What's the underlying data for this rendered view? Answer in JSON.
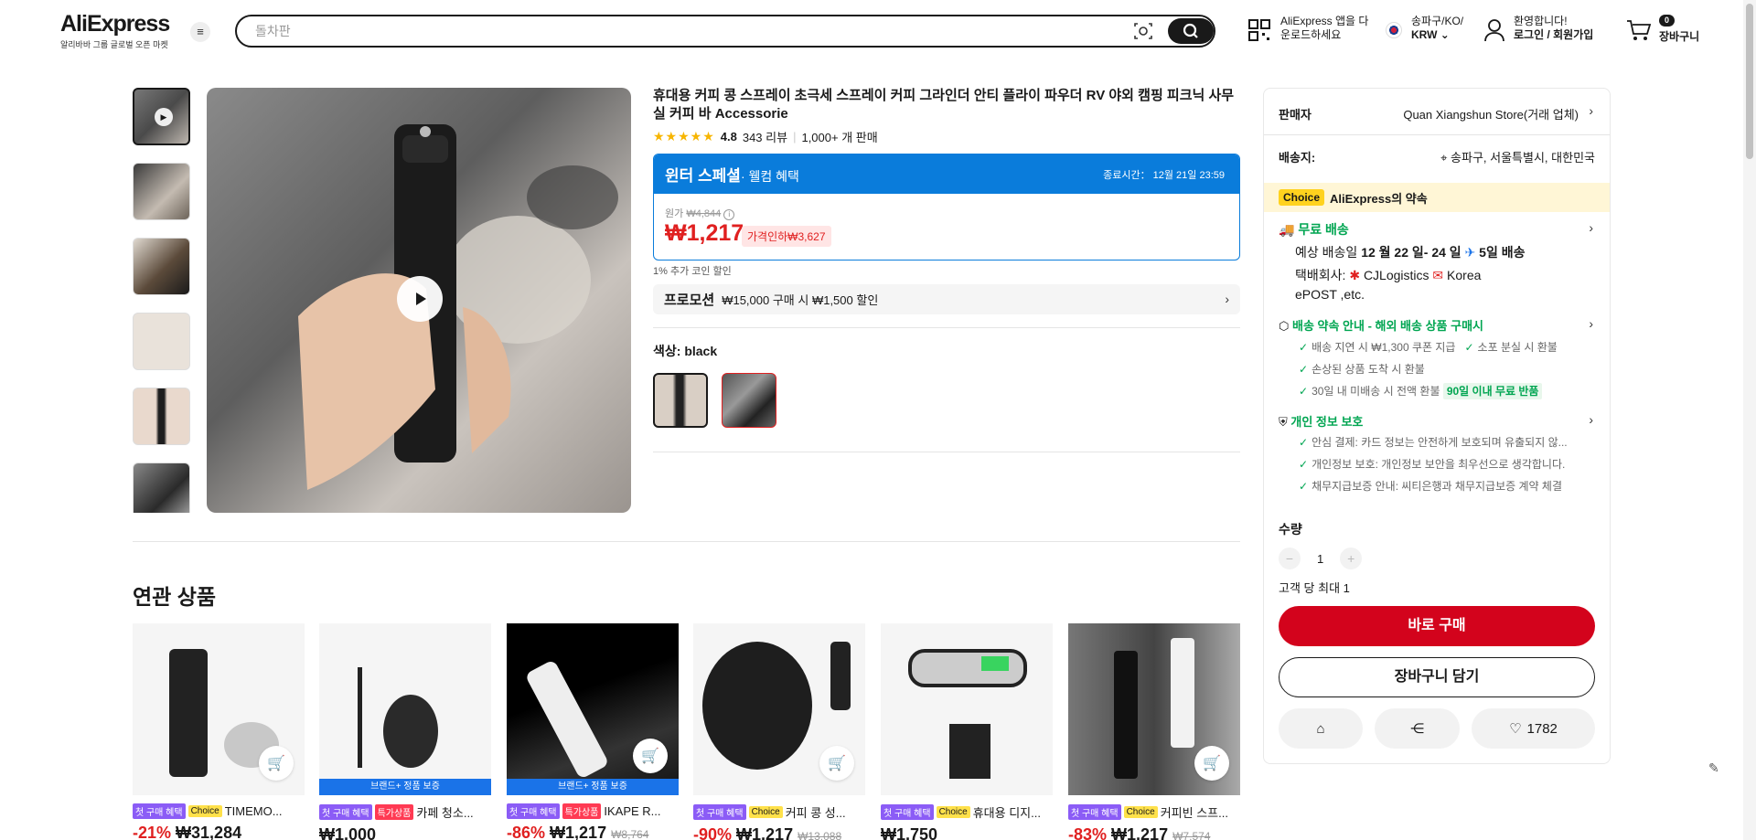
{
  "header": {
    "logo_text": "AliExpress",
    "logo_sub": "알리바바 그룹 글로벌 오픈 마켓",
    "search_placeholder": "돌차판",
    "app_line1": "AliExpress 앱을 다",
    "app_line2": "운로드하세요",
    "region_line1": "송파구/KO/",
    "region_line2": "KRW",
    "welcome_line1": "환영합니다!",
    "welcome_line2": "로그인 / 회원가입",
    "cart_count": "0",
    "cart_label": "장바구니"
  },
  "product": {
    "title": "휴대용 커피 콩 스프레이 초극세 스프레이 커피 그라인더 안티 플라이 파우더 RV 야외 캠핑 피크닉 사무실 커피 바 Accessorie",
    "rating": "4.8",
    "reviews": "343 리뷰",
    "sold": "1,000+ 개 판매",
    "promo_title": "윈터 스페셜",
    "promo_sub": "· 웰컴 혜택",
    "promo_end": "종료시간： 12월 21일 23:59",
    "orig_label": "원가",
    "orig_price": "₩4,844",
    "price": "₩1,217",
    "discount": "가격인하₩3,627",
    "coin": "1% 추가 코인 할인",
    "promotion_label": "프로모션",
    "promotion_text": "₩15,000 구매 시 ₩1,500 할인",
    "color_label": "색상:",
    "color_value": "black"
  },
  "related": {
    "title": "연관 상품",
    "items": [
      {
        "tag1": "첫 구매 혜택",
        "tag2": "Choice",
        "name": "TIMEMO...",
        "disc": "-21%",
        "price": "₩31,284",
        "orig": ""
      },
      {
        "tag1": "첫 구매 혜택",
        "tag2": "특가상품",
        "name": "카페 청소...",
        "disc": "",
        "price": "₩1,000",
        "orig": "",
        "brand": "브랜드+ 정품 보증"
      },
      {
        "tag1": "첫 구매 혜택",
        "tag2": "특가상품",
        "name": "IKAPE R...",
        "disc": "-86%",
        "price": "₩1,217",
        "orig": "₩8,764",
        "brand": "브랜드+ 정품 보증"
      },
      {
        "tag1": "첫 구매 혜택",
        "tag2": "Choice",
        "name": "커피 콩 성...",
        "disc": "-90%",
        "price": "₩1,217",
        "orig": "₩13,088"
      },
      {
        "tag1": "첫 구매 혜택",
        "tag2": "Choice",
        "name": "휴대용 디지...",
        "disc": "",
        "price": "₩1,750",
        "orig": ""
      },
      {
        "tag1": "첫 구매 혜택",
        "tag2": "Choice",
        "name": "커피빈 스프...",
        "disc": "-83%",
        "price": "₩1,217",
        "orig": "₩7,574"
      }
    ]
  },
  "side": {
    "seller_label": "판매자",
    "seller": "Quan Xiangshun Store(거래 업체)",
    "ship_to_label": "배송지:",
    "ship_to": "송파구, 서울특별시, 대한민국",
    "choice_badge": "Choice",
    "choice_text": "AliExpress의 약속",
    "free_ship": "무료 배송",
    "eta_prefix": "예상 배송일",
    "eta": "12 월 22 일- 24 일",
    "eta_days": "5일 배송",
    "carrier_label": "택배회사:",
    "carrier1": "CJLogistics",
    "carrier2": "Korea ePOST ,etc.",
    "guarantee": "배송 약속 안내 - 해외 배송 상품 구매시",
    "g1": "배송 지연 시 ₩1,300 쿠폰 지급",
    "g2": "소포 분실 시 환불",
    "g3": "손상된 상품 도착 시 환불",
    "g4": "30일 내 미배송 시 전액 환불",
    "g4_badge": "90일 이내 무료 반품",
    "privacy": "개인 정보 보호",
    "p1": "안심 결제: 카드 정보는 안전하게 보호되며 유출되지 않...",
    "p2": "개인정보 보호: 개인정보 보안을 최우선으로 생각합니다.",
    "p3": "채무지급보증 안내: 씨티은행과 채무지급보증 계약 체결",
    "qty_label": "수량",
    "qty": "1",
    "limit": "고객 당 최대 1",
    "buy_now": "바로 구매",
    "add_cart": "장바구니 담기",
    "wish_count": "1782"
  }
}
